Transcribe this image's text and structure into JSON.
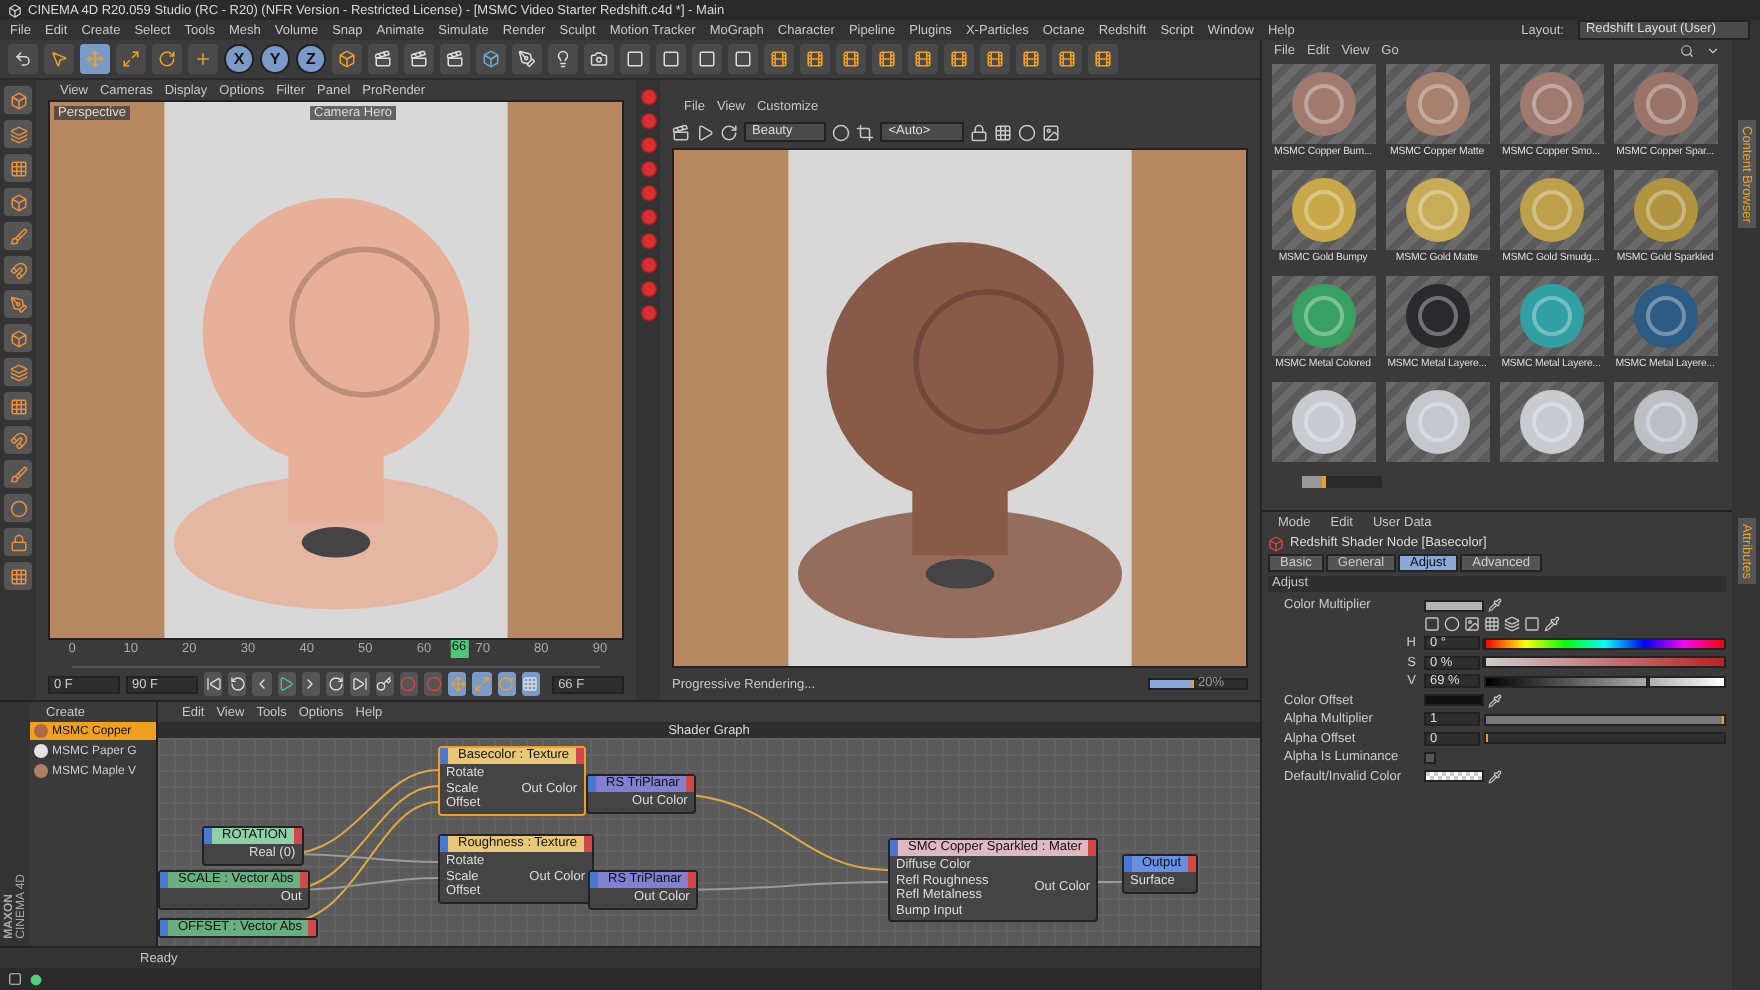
{
  "window": {
    "title": "CINEMA 4D R20.059 Studio (RC - R20) (NFR Version - Restricted License) - [MSMC Video Starter Redshift.c4d *] - Main"
  },
  "menu": [
    "File",
    "Edit",
    "Create",
    "Select",
    "Tools",
    "Mesh",
    "Volume",
    "Snap",
    "Animate",
    "Simulate",
    "Render",
    "Sculpt",
    "Motion Tracker",
    "MoGraph",
    "Character",
    "Pipeline",
    "Plugins",
    "X-Particles",
    "Octane",
    "Redshift",
    "Script",
    "Window",
    "Help"
  ],
  "layout": {
    "label": "Layout:",
    "value": "Redshift Layout (User)"
  },
  "axes": [
    {
      "label": "X",
      "selected": true
    },
    {
      "label": "Y",
      "selected": true
    },
    {
      "label": "Z",
      "selected": true
    }
  ],
  "viewport": {
    "menu": [
      "View",
      "Cameras",
      "Display",
      "Options",
      "Filter",
      "Panel",
      "ProRender"
    ],
    "camera": "Perspective",
    "camera_name": "Camera Hero"
  },
  "timeline": {
    "ticks": [
      "0",
      "10",
      "20",
      "30",
      "40",
      "50",
      "60",
      "70",
      "80",
      "90"
    ],
    "marker": "66",
    "level": 0.733,
    "frame_field": "66 F",
    "start_field": "0 F",
    "end_field": "90 F"
  },
  "render_view": {
    "menu": [
      "File",
      "View",
      "Customize"
    ],
    "pass": "Beauty",
    "camera": "<Auto>",
    "status": "Progressive Rendering...",
    "progress": {
      "level": 0.45,
      "reading": "20%"
    }
  },
  "content_browser": {
    "menu": [
      "File",
      "Edit",
      "View",
      "Go"
    ],
    "side_tab": {
      "label": "Content Browser",
      "selected": true
    },
    "zoom": {
      "level": 0.3
    },
    "materials": [
      {
        "name": "MSMC Copper Bum...",
        "color": "#a07a6e"
      },
      {
        "name": "MSMC Copper Matte",
        "color": "#a8806e"
      },
      {
        "name": "MSMC Copper Smo...",
        "color": "#a07a6e"
      },
      {
        "name": "MSMC Copper Spar...",
        "color": "#9a7468"
      },
      {
        "name": "MSMC Gold Bumpy",
        "color": "#c8a848"
      },
      {
        "name": "MSMC Gold Matte",
        "color": "#c8ac58"
      },
      {
        "name": "MSMC Gold Smudg...",
        "color": "#bca04c"
      },
      {
        "name": "MSMC Gold Sparkled",
        "color": "#b09440"
      },
      {
        "name": "MSMC Metal Colored",
        "color": "#38a060"
      },
      {
        "name": "MSMC Metal Layere...",
        "color": "#2a2a2e"
      },
      {
        "name": "MSMC Metal Layere...",
        "color": "#30a0a4"
      },
      {
        "name": "MSMC Metal Layere...",
        "color": "#2c5c84"
      },
      {
        "color": "#c8ccd0"
      },
      {
        "color": "#c4c8cc"
      },
      {
        "color": "#c8ccd0"
      },
      {
        "color": "#bcc0c4"
      }
    ]
  },
  "attributes": {
    "menu": [
      "Mode",
      "Edit",
      "User Data"
    ],
    "side_tab": {
      "label": "Attributes",
      "selected": true
    },
    "node": "Redshift Shader Node [Basecolor]",
    "tabs": [
      {
        "label": "Basic",
        "selected": false
      },
      {
        "label": "General",
        "selected": false
      },
      {
        "label": "Adjust",
        "selected": true
      },
      {
        "label": "Advanced",
        "selected": false
      }
    ],
    "section": "Adjust",
    "rows": [
      {
        "kind": "color",
        "label": "Color Multiplier",
        "color": "#b4b4b4"
      },
      {
        "kind": "picker"
      },
      {
        "kind": "hsv",
        "label": "H",
        "value": "0 °",
        "level": 0
      },
      {
        "kind": "hsv",
        "label": "S",
        "value": "0 %",
        "level": 0
      },
      {
        "kind": "hsv",
        "label": "V",
        "value": "69 %",
        "level": 0.69
      },
      {
        "kind": "color",
        "label": "Color Offset",
        "color": "#111111"
      },
      {
        "kind": "slider",
        "label": "Alpha Multiplier",
        "value": "1",
        "level": 1
      },
      {
        "kind": "slider",
        "label": "Alpha Offset",
        "value": "0",
        "level": 0
      },
      {
        "kind": "checkbox",
        "label": "Alpha Is Luminance",
        "checked": false
      },
      {
        "kind": "checker",
        "label": "Default/Invalid Color"
      }
    ]
  },
  "material_manager": {
    "menu": "Create",
    "materials": [
      {
        "name": "MSMC Copper",
        "selected": true,
        "color": "#b06848"
      },
      {
        "name": "MSMC Paper G",
        "selected": false,
        "color": "#e4e4e4"
      },
      {
        "name": "MSMC Maple V",
        "selected": false,
        "color": "#b08060"
      }
    ]
  },
  "node_editor": {
    "menu": [
      "Edit",
      "View",
      "Tools",
      "Options",
      "Help"
    ],
    "title": "Shader Graph",
    "nodes": [
      {
        "title": "Basecolor : Texture",
        "color": "#e8c878",
        "selected": true,
        "inputs": [
          "Rotate",
          "Scale",
          "Offset"
        ],
        "outputs": [
          "Out Color"
        ]
      },
      {
        "title": "RS TriPlanar",
        "color": "#8480d0",
        "selected": false,
        "outputs": [
          "Out Color"
        ]
      },
      {
        "title": "Roughness : Texture",
        "color": "#e8c878",
        "selected": false,
        "inputs": [
          "Rotate",
          "Scale",
          "Offset"
        ],
        "outputs": [
          "Out Color"
        ]
      },
      {
        "title": "RS TriPlanar",
        "color": "#8480d0",
        "selected": false,
        "outputs": [
          "Out Color"
        ]
      },
      {
        "title": "ROTATION",
        "color": "#90d0a8",
        "selected": false,
        "outputs": [
          "Real (0)"
        ]
      },
      {
        "title": "SCALE : Vector Abs",
        "color": "#68b080",
        "selected": false,
        "outputs": [
          "Out"
        ]
      },
      {
        "title": "OFFSET : Vector Abs",
        "color": "#68b080",
        "selected": false
      },
      {
        "title": "SMC Copper Sparkled : Mater",
        "color": "#e0b8c0",
        "selected": false,
        "inputs": [
          "Diffuse Color",
          "Refl Roughness",
          "Refl Metalness",
          "Bump Input"
        ],
        "outputs": [
          "Out Color"
        ]
      },
      {
        "title": "Output",
        "color": "#6890e0",
        "selected": false,
        "inputs": [
          "Surface"
        ]
      }
    ]
  },
  "logo": [
    "MAXON",
    "CINEMA 4D"
  ],
  "status": "Ready"
}
